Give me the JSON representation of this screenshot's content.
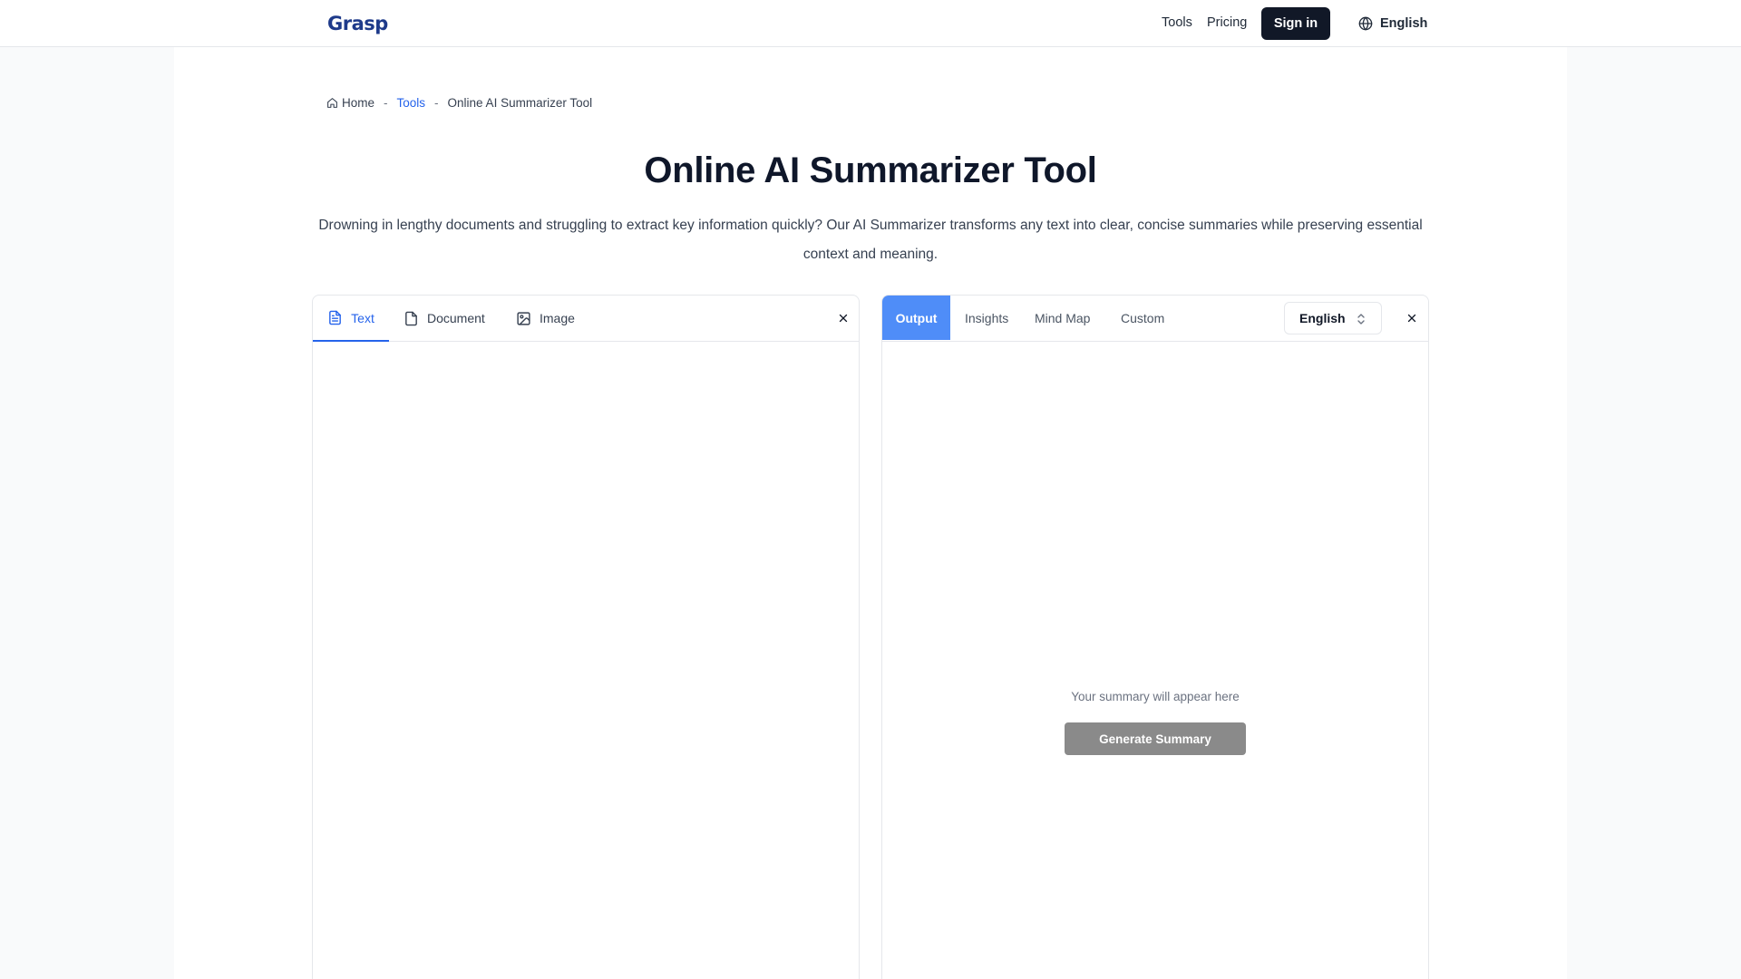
{
  "header": {
    "logo_text": "Grasp",
    "nav_tools": "Tools",
    "nav_pricing": "Pricing",
    "signin_label": "Sign in",
    "language": "English"
  },
  "breadcrumb": {
    "home": "Home",
    "sep1": "-",
    "tools": "Tools",
    "sep2": "-",
    "current": "Online AI Summarizer Tool"
  },
  "page": {
    "title": "Online AI Summarizer Tool",
    "description": "Drowning in lengthy documents and struggling to extract key information quickly? Our AI Summarizer transforms any text into clear, concise summaries while preserving essential context and meaning."
  },
  "input_panel": {
    "tabs": [
      {
        "label": "Text",
        "icon": "file-text-icon",
        "active": true
      },
      {
        "label": "Document",
        "icon": "file-icon",
        "active": false
      },
      {
        "label": "Image",
        "icon": "image-icon",
        "active": false
      }
    ]
  },
  "output_panel": {
    "tabs": [
      {
        "label": "Output",
        "active": true
      },
      {
        "label": "Insights",
        "active": false
      },
      {
        "label": "Mind Map",
        "active": false
      },
      {
        "label": "Custom",
        "active": false
      }
    ],
    "language_select": "English",
    "placeholder": "Your summary will appear here",
    "generate_label": "Generate Summary"
  },
  "colors": {
    "accent": "#2563eb",
    "active_tab_bg": "#4f8df8",
    "button_dark": "#111827",
    "button_disabled": "#8a8a8a"
  }
}
